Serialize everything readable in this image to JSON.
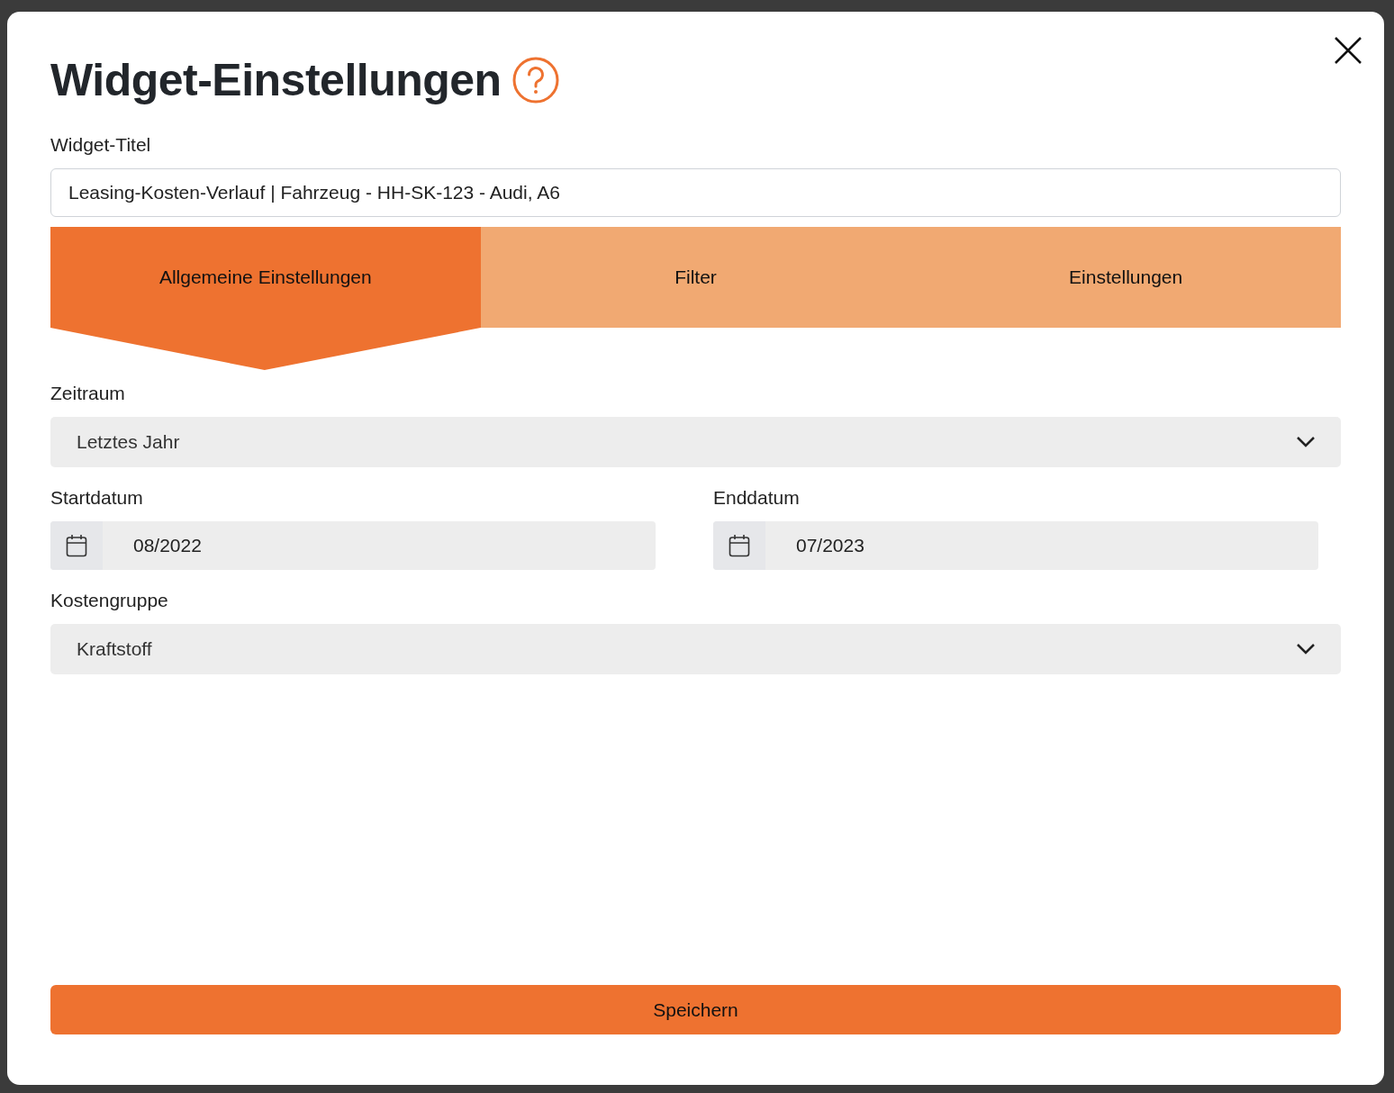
{
  "dialog": {
    "title": "Widget-Einstellungen"
  },
  "title_field": {
    "label": "Widget-Titel",
    "value": "Leasing-Kosten-Verlauf | Fahrzeug - HH-SK-123 - Audi, A6"
  },
  "tabs": [
    {
      "label": "Allgemeine Einstellungen",
      "selected": true
    },
    {
      "label": "Filter",
      "selected": false
    },
    {
      "label": "Einstellungen",
      "selected": false
    }
  ],
  "period": {
    "label": "Zeitraum",
    "value": "Letztes Jahr"
  },
  "dates": [
    {
      "label": "Startdatum",
      "value": "08/2022"
    },
    {
      "label": "Enddatum",
      "value": "07/2023"
    }
  ],
  "cost_group": {
    "label": "Kostengruppe",
    "value": "Kraftstoff"
  },
  "save_button": "Speichern"
}
